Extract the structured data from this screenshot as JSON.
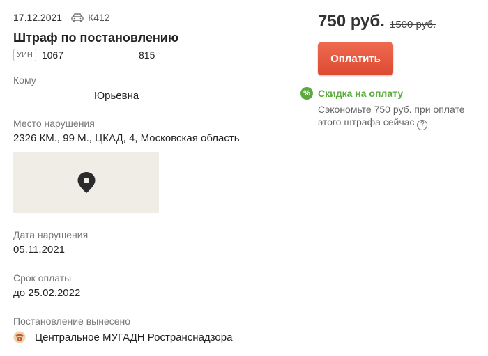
{
  "fine": {
    "date": "17.12.2021",
    "car_plate": "К412",
    "title": "Штраф по постановлению",
    "uin_badge": "УИН",
    "uin_start": "1067",
    "uin_end": "815"
  },
  "recipient": {
    "label": "Кому",
    "value": "Юрьевна"
  },
  "location": {
    "label": "Место нарушения",
    "value": "2326 КМ., 99 М., ЦКАД, 4, Московская область"
  },
  "violation_date": {
    "label": "Дата нарушения",
    "value": "05.11.2021"
  },
  "due": {
    "label": "Срок оплаты",
    "value": "до 25.02.2022"
  },
  "issuer": {
    "label": "Постановление вынесено",
    "value": "Центральное МУГАДН Ространснадзора"
  },
  "payment": {
    "price": "750 руб.",
    "old_price": "1500 руб.",
    "pay_label": "Оплатить",
    "discount_icon": "%",
    "discount_title": "Скидка на оплату",
    "discount_text": "Сэкономьте 750 руб. при оплате этого штрафа сейчас",
    "help_icon": "?"
  },
  "colors": {
    "accent": "#e4553c",
    "discount": "#5aab3b",
    "map_bg": "#f0ede7"
  }
}
